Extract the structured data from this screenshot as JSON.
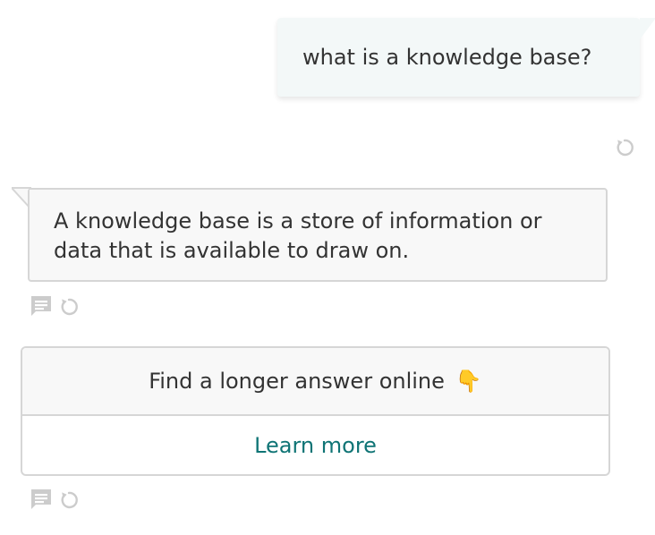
{
  "conversation": {
    "user_message": "what is a knowledge base?",
    "bot_message": "A knowledge base is a store of information or data that is available to draw on.",
    "card": {
      "title": "Find a longer answer online",
      "emoji": "👇",
      "link_label": "Learn more"
    }
  },
  "icons": {
    "retry": "retry-icon",
    "feedback": "chat-bubble-icon",
    "pointing_down": "pointing-down-emoji"
  },
  "colors": {
    "user_bubble_bg": "#f3f8f8",
    "bot_bubble_bg": "#f8f8f8",
    "border": "#d6d6d6",
    "link": "#0f7475",
    "icon": "#cccccc",
    "text": "#333333"
  }
}
